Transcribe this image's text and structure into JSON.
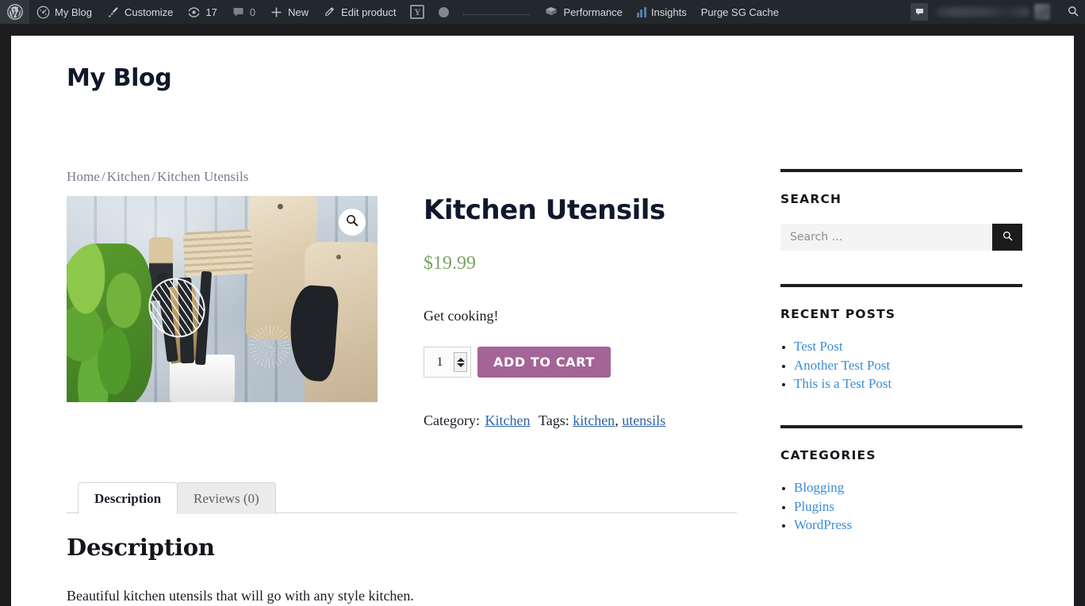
{
  "admin_bar": {
    "wp_logo": "wordpress-logo-icon",
    "items": [
      {
        "label": "My Blog",
        "icon": "dashboard-icon",
        "name": "site-name"
      },
      {
        "label": "Customize",
        "icon": "paintbrush-icon",
        "name": "customize"
      },
      {
        "label": "17",
        "icon": "updates-icon",
        "name": "updates"
      },
      {
        "label": "0",
        "icon": "comment-bubble-icon",
        "name": "comments"
      },
      {
        "label": "New",
        "icon": "plus-icon",
        "name": "new-content"
      },
      {
        "label": "Edit product",
        "icon": "pencil-icon",
        "name": "edit-product"
      }
    ],
    "yoast_glyph": "Y",
    "right_items": [
      {
        "label": "Performance",
        "icon": "performance-icon",
        "name": "performance"
      },
      {
        "label": "Insights",
        "icon": "bar-chart-icon",
        "name": "insights"
      },
      {
        "label": "Purge SG Cache",
        "icon": "",
        "name": "purge-sg-cache"
      }
    ],
    "account": {
      "notification_icon": "notification-flag-icon",
      "greeting_redacted": true,
      "avatar": "user-avatar",
      "search_icon": "search-icon"
    },
    "bar_color": "#23282d"
  },
  "site": {
    "title": "My Blog"
  },
  "breadcrumb": {
    "items": [
      "Home",
      "Kitchen",
      "Kitchen Utensils"
    ],
    "separator": "/"
  },
  "product": {
    "title": "Kitchen Utensils",
    "price": "$19.99",
    "price_color": "#77a464",
    "excerpt": "Get cooking!",
    "quantity": "1",
    "add_to_cart_label": "ADD TO CART",
    "add_to_cart_color": "#a46497",
    "zoom_icon": "magnifier-icon",
    "image_alt": "kitchen utensils in a white holder with basil plant and wooden cutting boards",
    "meta": {
      "category_label": "Category:",
      "categories": [
        "Kitchen"
      ],
      "tags_label": "Tags:",
      "tags": [
        "kitchen",
        "utensils"
      ],
      "link_color": "#2b62a8"
    }
  },
  "tabs": [
    {
      "label": "Description",
      "active": true,
      "name": "tab-description"
    },
    {
      "label": "Reviews (0)",
      "active": false,
      "name": "tab-reviews"
    }
  ],
  "tab_panel": {
    "heading": "Description",
    "body": "Beautiful kitchen utensils that will go with any style kitchen."
  },
  "sidebar": {
    "widgets": [
      {
        "type": "search",
        "title": "SEARCH",
        "placeholder": "Search …",
        "value": "",
        "submit_icon": "search-icon"
      },
      {
        "type": "list",
        "title": "RECENT POSTS",
        "items": [
          "Test Post",
          "Another Test Post",
          "This is a Test Post"
        ]
      },
      {
        "type": "list",
        "title": "CATEGORIES",
        "items": [
          "Blogging",
          "Plugins",
          "WordPress"
        ]
      }
    ],
    "link_color": "#3c8cd4"
  }
}
